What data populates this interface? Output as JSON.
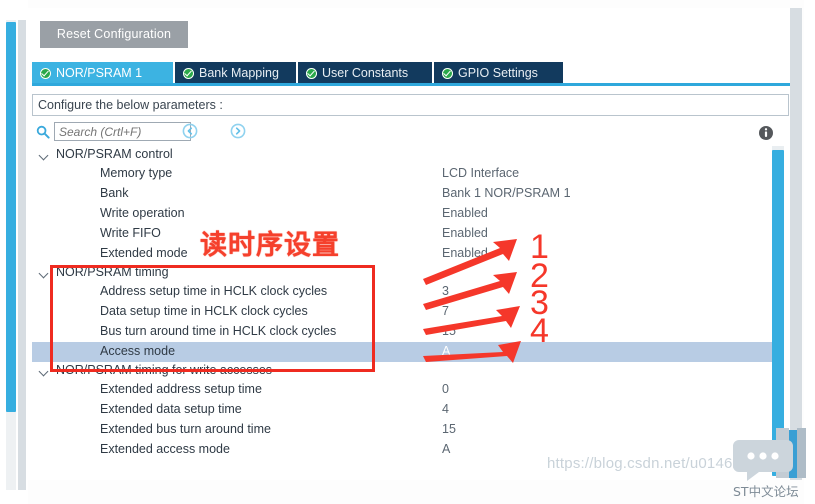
{
  "toolbar": {
    "reset_label": "Reset Configuration"
  },
  "tabs": [
    {
      "label": "NOR/PSRAM 1",
      "active": true,
      "icon": "check-circle-icon"
    },
    {
      "label": "Bank Mapping",
      "active": false,
      "icon": "check-circle-icon"
    },
    {
      "label": "User Constants",
      "active": false,
      "icon": "check-circle-icon"
    },
    {
      "label": "GPIO Settings",
      "active": false,
      "icon": "check-circle-icon"
    }
  ],
  "config_bar": {
    "text": "Configure the below parameters :"
  },
  "search": {
    "placeholder": "Search (Crtl+F)",
    "value": "",
    "icon": "search-icon",
    "prev_icon": "chevron-left-circle-icon",
    "next_icon": "chevron-right-circle-icon"
  },
  "info": {
    "icon": "info-icon"
  },
  "groups": [
    {
      "label": "NOR/PSRAM control",
      "expanded": true,
      "rows": [
        {
          "name": "Memory type",
          "value": "LCD Interface",
          "selected": false
        },
        {
          "name": "Bank",
          "value": "Bank 1 NOR/PSRAM 1",
          "selected": false
        },
        {
          "name": "Write operation",
          "value": "Enabled",
          "selected": false
        },
        {
          "name": "Write FIFO",
          "value": "Enabled",
          "selected": false
        },
        {
          "name": "Extended mode",
          "value": "Enabled",
          "selected": false
        }
      ]
    },
    {
      "label": "NOR/PSRAM timing",
      "expanded": true,
      "rows": [
        {
          "name": "Address setup time in HCLK clock cycles",
          "value": "3",
          "selected": false
        },
        {
          "name": "Data setup time in HCLK clock cycles",
          "value": "7",
          "selected": false
        },
        {
          "name": "Bus turn around time in HCLK clock cycles",
          "value": "15",
          "selected": false
        },
        {
          "name": "Access mode",
          "value": "A",
          "selected": true
        }
      ]
    },
    {
      "label": "NOR/PSRAM timing for write accesses",
      "expanded": true,
      "rows": [
        {
          "name": "Extended address setup time",
          "value": "0",
          "selected": false
        },
        {
          "name": "Extended data setup time",
          "value": "4",
          "selected": false
        },
        {
          "name": "Extended bus turn around time",
          "value": "15",
          "selected": false
        },
        {
          "name": "Extended access mode",
          "value": "A",
          "selected": false
        }
      ]
    }
  ],
  "annotations": {
    "note_cn": "读时序设置",
    "callout_numbers": [
      "1",
      "2",
      "3",
      "4"
    ],
    "box_color": "#ef2b20",
    "arrow_color": "#f5372a"
  },
  "watermark": {
    "url": "https://blog.csdn.net/u014627020",
    "logo_text": "ST中文论坛",
    "logo_icon": "chat-bubble-icon"
  }
}
